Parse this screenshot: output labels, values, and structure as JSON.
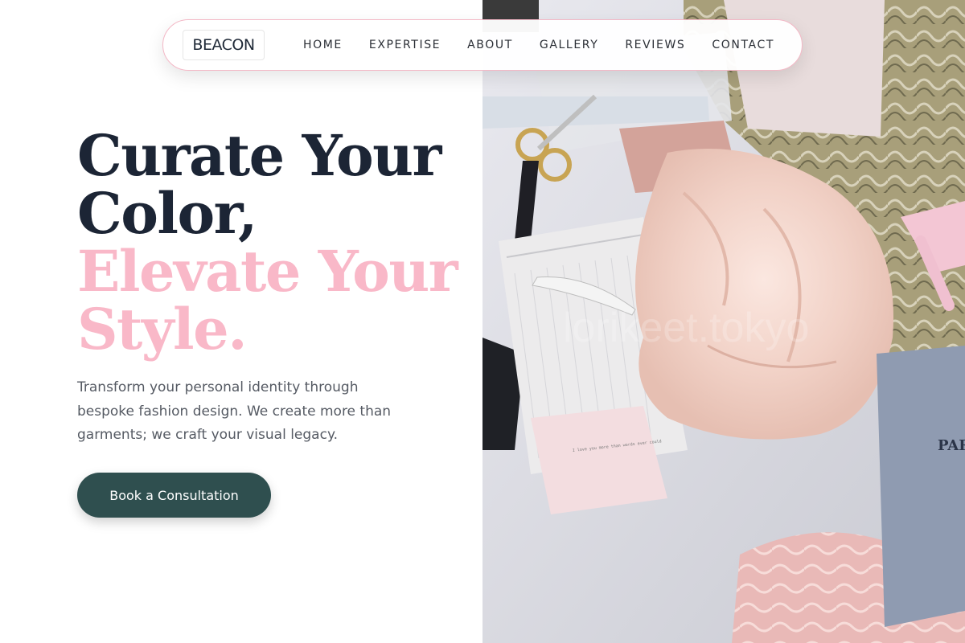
{
  "nav": {
    "logo": "BEACON",
    "links": [
      "HOME",
      "EXPERTISE",
      "ABOUT",
      "GALLERY",
      "REVIEWS",
      "CONTACT"
    ]
  },
  "hero": {
    "headline_line1": "Curate Your",
    "headline_line2": "Color,",
    "headline_accent_line1": "Elevate Your",
    "headline_accent_line2": "Style.",
    "description": "Transform your personal identity through bespoke fashion design. We create more than garments; we craft your visual legacy.",
    "cta_label": "Book a Consultation"
  },
  "image": {
    "watermark": "lorikeet.tokyo",
    "note_text": "I love you more than words ever could",
    "sign_text": "PAR SOU"
  },
  "colors": {
    "headline_dark": "#1c2535",
    "headline_accent": "#f9b8c8",
    "cta_background": "#2f4f4f",
    "nav_border": "#f3b8c6"
  }
}
